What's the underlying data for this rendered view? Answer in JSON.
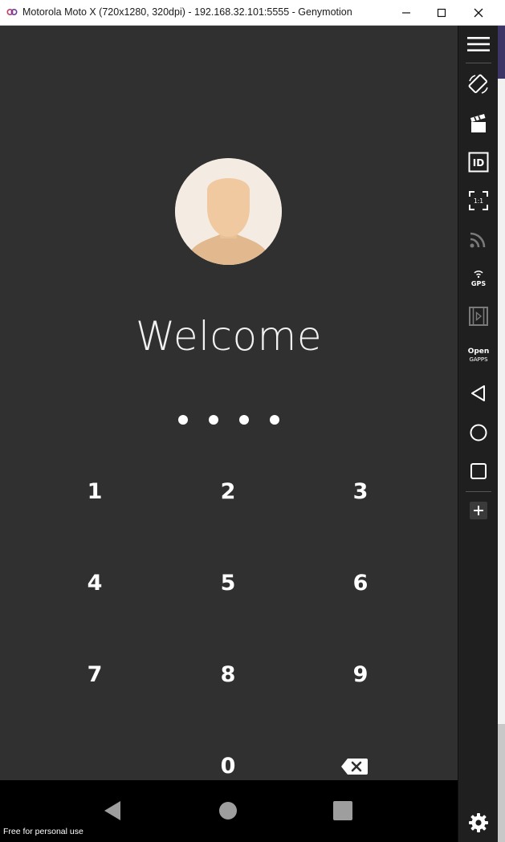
{
  "window": {
    "title": "Motorola Moto X (720x1280, 320dpi) - 192.168.32.101:5555 - Genymotion",
    "controls": [
      "minimize",
      "maximize",
      "close"
    ]
  },
  "lockscreen": {
    "avatar_icon": "user-avatar-icon",
    "welcome_text": "Welcome",
    "pin_entered_count": 4,
    "keys": [
      "1",
      "2",
      "3",
      "4",
      "5",
      "6",
      "7",
      "8",
      "9",
      "0"
    ],
    "backspace_icon": "backspace-icon"
  },
  "navbar": {
    "buttons": [
      "back-icon",
      "home-icon",
      "recents-icon"
    ]
  },
  "watermark": "Free for personal use",
  "toolbar": {
    "items": [
      {
        "name": "menu",
        "icon": "hamburger-menu-icon"
      },
      {
        "name": "rotate",
        "icon": "rotate-device-icon"
      },
      {
        "name": "capture",
        "icon": "clapperboard-icon"
      },
      {
        "name": "device-id",
        "icon": "id-icon",
        "label": "ID"
      },
      {
        "name": "pixel-perfect",
        "icon": "pixel-perfect-icon",
        "label": "1:1"
      },
      {
        "name": "network",
        "icon": "network-icon"
      },
      {
        "name": "gps",
        "icon": "gps-icon",
        "label": "GPS"
      },
      {
        "name": "media",
        "icon": "film-icon"
      },
      {
        "name": "open-gapps",
        "icon": "open-gapps-icon",
        "label_line1": "Open",
        "label_line2": "GAPPS"
      },
      {
        "name": "back",
        "icon": "back-icon"
      },
      {
        "name": "home",
        "icon": "home-icon"
      },
      {
        "name": "recents",
        "icon": "recents-icon"
      },
      {
        "name": "more",
        "icon": "plus-icon"
      },
      {
        "name": "settings",
        "icon": "gear-icon"
      }
    ]
  },
  "colors": {
    "screen_bg": "#303030",
    "toolbar_bg": "#1f1f1f",
    "navbar_bg": "#000000",
    "avatar_bg": "#f4ece3",
    "skin": "#f0c9a0",
    "accent_scroll": "#3d3566"
  }
}
